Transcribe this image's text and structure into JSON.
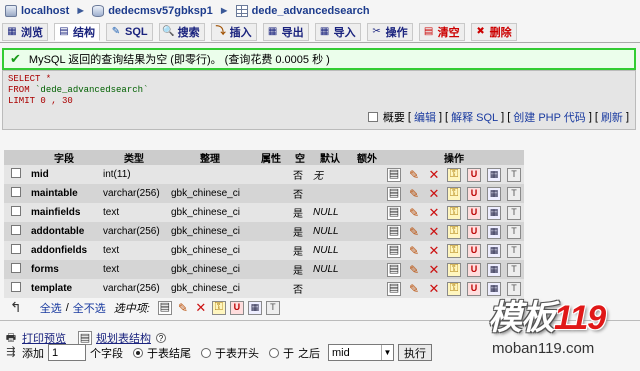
{
  "breadcrumb": {
    "server": "localhost",
    "database": "dedecmsv57gbksp1",
    "table": "dede_advancedsearch"
  },
  "tabs": [
    {
      "label": "浏览",
      "icon": "browse-icon"
    },
    {
      "label": "结构",
      "icon": "structure-icon"
    },
    {
      "label": "SQL",
      "icon": "sql-icon"
    },
    {
      "label": "搜索",
      "icon": "search-icon"
    },
    {
      "label": "插入",
      "icon": "insert-icon"
    },
    {
      "label": "导出",
      "icon": "export-icon"
    },
    {
      "label": "导入",
      "icon": "import-icon"
    },
    {
      "label": "操作",
      "icon": "operations-icon"
    },
    {
      "label": "清空",
      "icon": "empty-icon"
    },
    {
      "label": "删除",
      "icon": "drop-icon"
    }
  ],
  "notice": {
    "text": "MySQL 返回的查询结果为空 (即零行)。 (查询花费 0.0005 秒 )"
  },
  "sql": {
    "line1_kw": "SELECT",
    "line1_rest": " *",
    "line2_kw": "FROM",
    "line2_str": "`dede_advancedsearch`",
    "line3_kw": "LIMIT",
    "line3_rest": "0 , 30"
  },
  "sql_links": {
    "profiling": "概要",
    "edit": "编辑",
    "explain": "解释 SQL",
    "create_php": "创建 PHP 代码",
    "refresh": "刷新"
  },
  "table": {
    "headers": [
      "字段",
      "类型",
      "整理",
      "属性",
      "空",
      "默认",
      "额外",
      "操作"
    ],
    "rows": [
      {
        "field": "mid",
        "type": "int(11)",
        "collation": "",
        "attributes": "",
        "null": "否",
        "default": "无",
        "extra": ""
      },
      {
        "field": "maintable",
        "type": "varchar(256)",
        "collation": "gbk_chinese_ci",
        "attributes": "",
        "null": "否",
        "default": "",
        "extra": ""
      },
      {
        "field": "mainfields",
        "type": "text",
        "collation": "gbk_chinese_ci",
        "attributes": "",
        "null": "是",
        "default": "NULL",
        "extra": ""
      },
      {
        "field": "addontable",
        "type": "varchar(256)",
        "collation": "gbk_chinese_ci",
        "attributes": "",
        "null": "是",
        "default": "NULL",
        "extra": ""
      },
      {
        "field": "addonfields",
        "type": "text",
        "collation": "gbk_chinese_ci",
        "attributes": "",
        "null": "是",
        "default": "NULL",
        "extra": ""
      },
      {
        "field": "forms",
        "type": "text",
        "collation": "gbk_chinese_ci",
        "attributes": "",
        "null": "是",
        "default": "NULL",
        "extra": ""
      },
      {
        "field": "template",
        "type": "varchar(256)",
        "collation": "gbk_chinese_ci",
        "attributes": "",
        "null": "否",
        "default": "",
        "extra": ""
      }
    ]
  },
  "selection": {
    "check_all": "全选",
    "uncheck_all": "全不选",
    "with_selected": "选中项:"
  },
  "bottom": {
    "print_view": "打印预览",
    "relation_view": "规划表结构",
    "add_label": "添加",
    "add_count": "1",
    "fields_label": "个字段",
    "at_end": "于表结尾",
    "at_begin": "于表开头",
    "after_label": "于",
    "after_suffix": "之后",
    "after_column": "mid",
    "go_button": "执行"
  },
  "watermark": {
    "brand_text": "模板",
    "brand_num": "119",
    "url": "moban119.com"
  }
}
